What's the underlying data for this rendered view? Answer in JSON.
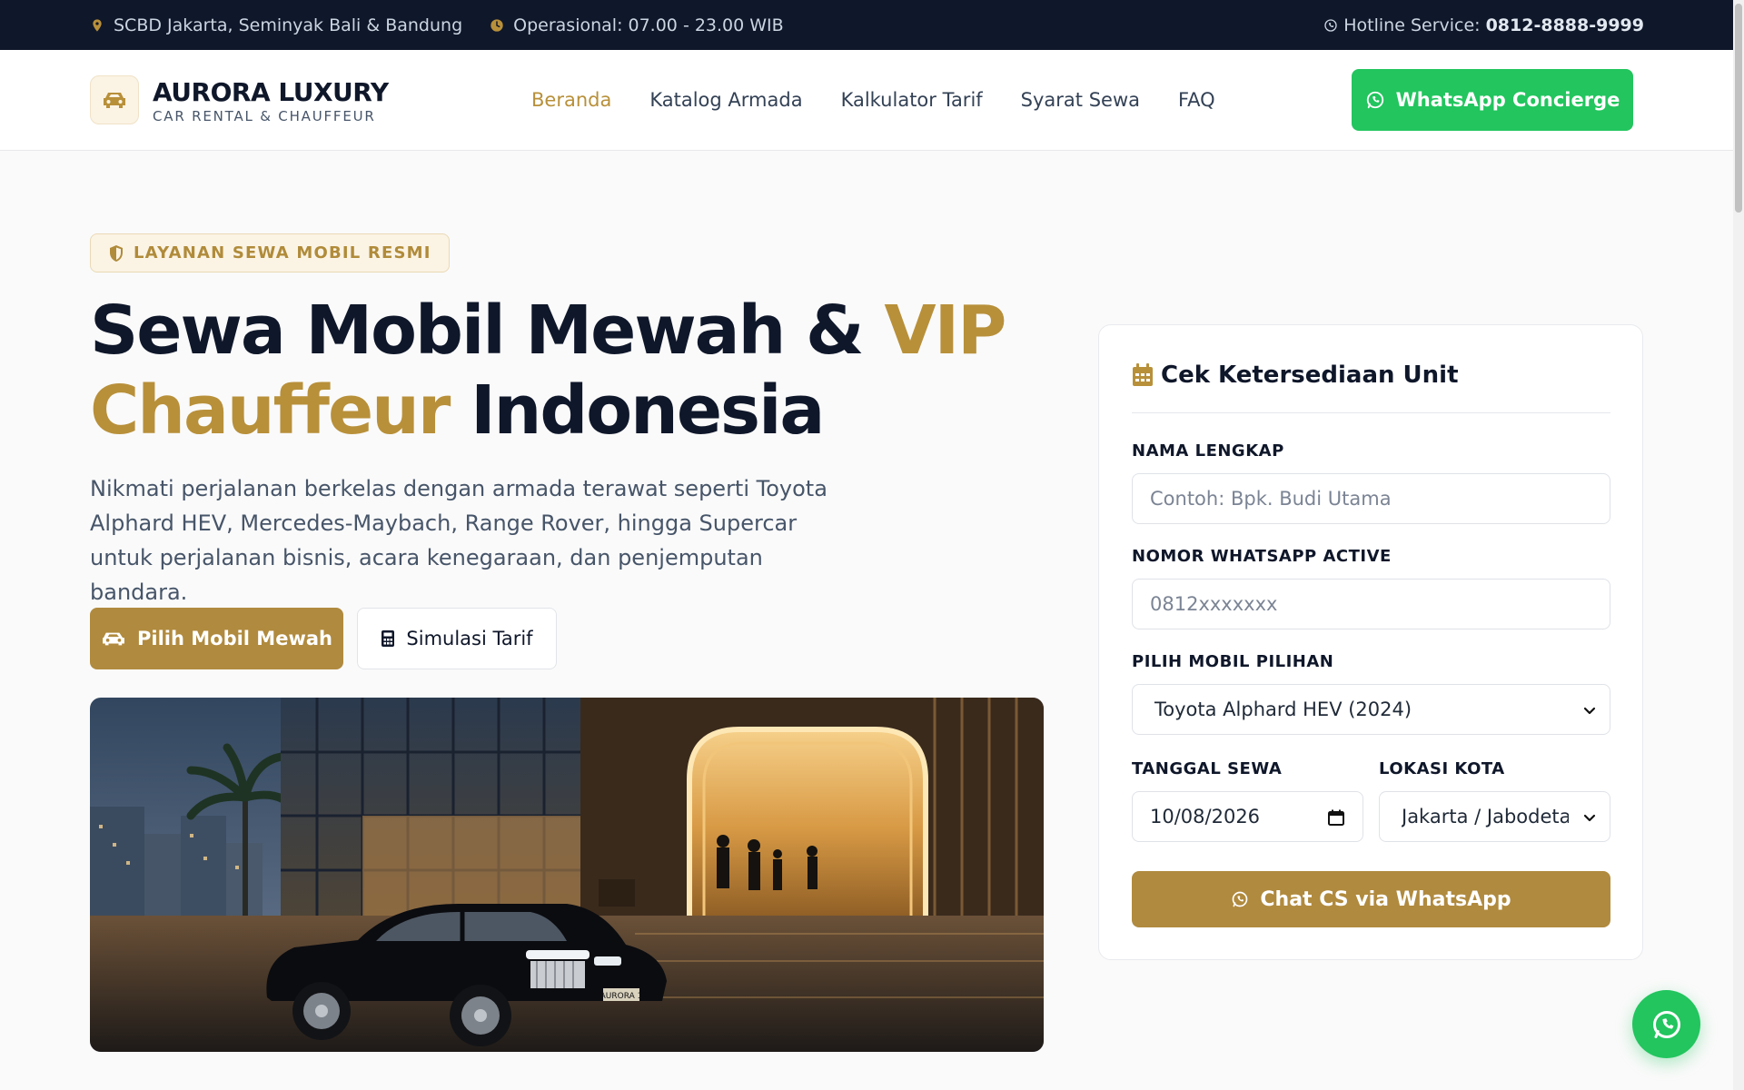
{
  "topbar": {
    "location": "SCBD Jakarta, Seminyak Bali & Bandung",
    "hours": "Operasional: 07.00 - 23.00 WIB",
    "hotline_label": "Hotline Service:",
    "hotline_number": "0812-8888-9999"
  },
  "header": {
    "brand_name": "AURORA LUXURY",
    "brand_sub": "CAR RENTAL & CHAUFFEUR",
    "nav": [
      "Beranda",
      "Katalog Armada",
      "Kalkulator Tarif",
      "Syarat Sewa",
      "FAQ"
    ],
    "active_nav": "Beranda",
    "cta": "WhatsApp Concierge"
  },
  "hero": {
    "badge": "LAYANAN SEWA MOBIL RESMI",
    "title_part1": "Sewa Mobil Mewah & ",
    "title_gold1": "VIP",
    "title_gold2": "Chauffeur",
    "title_part2": " Indonesia",
    "lead": "Nikmati perjalanan berkelas dengan armada terawat seperti Toyota Alphard HEV, Mercedes-Maybach, Range Rover, hingga Supercar untuk perjalanan bisnis, acara kenegaraan, dan penjemputan bandara.",
    "btn_primary": "Pilih Mobil Mewah",
    "btn_secondary": "Simulasi Tarif",
    "plate_text": "AURORA 1"
  },
  "form": {
    "title": "Cek Ketersediaan Unit",
    "name_label": "NAMA LENGKAP",
    "name_placeholder": "Contoh: Bpk. Budi Utama",
    "wa_label": "NOMOR WHATSAPP ACTIVE",
    "wa_placeholder": "0812xxxxxxx",
    "car_label": "PILIH MOBIL PILIHAN",
    "car_value": "Toyota Alphard HEV (2024)",
    "date_label": "TANGGAL SEWA",
    "date_value": "10/08/2026",
    "city_label": "LOKASI KOTA",
    "city_value": "Jakarta / Jabodetabek",
    "submit": "Chat CS via WhatsApp"
  },
  "colors": {
    "gold": "#b8903a",
    "navy": "#0f172a",
    "whatsapp_green": "#22c55e"
  }
}
